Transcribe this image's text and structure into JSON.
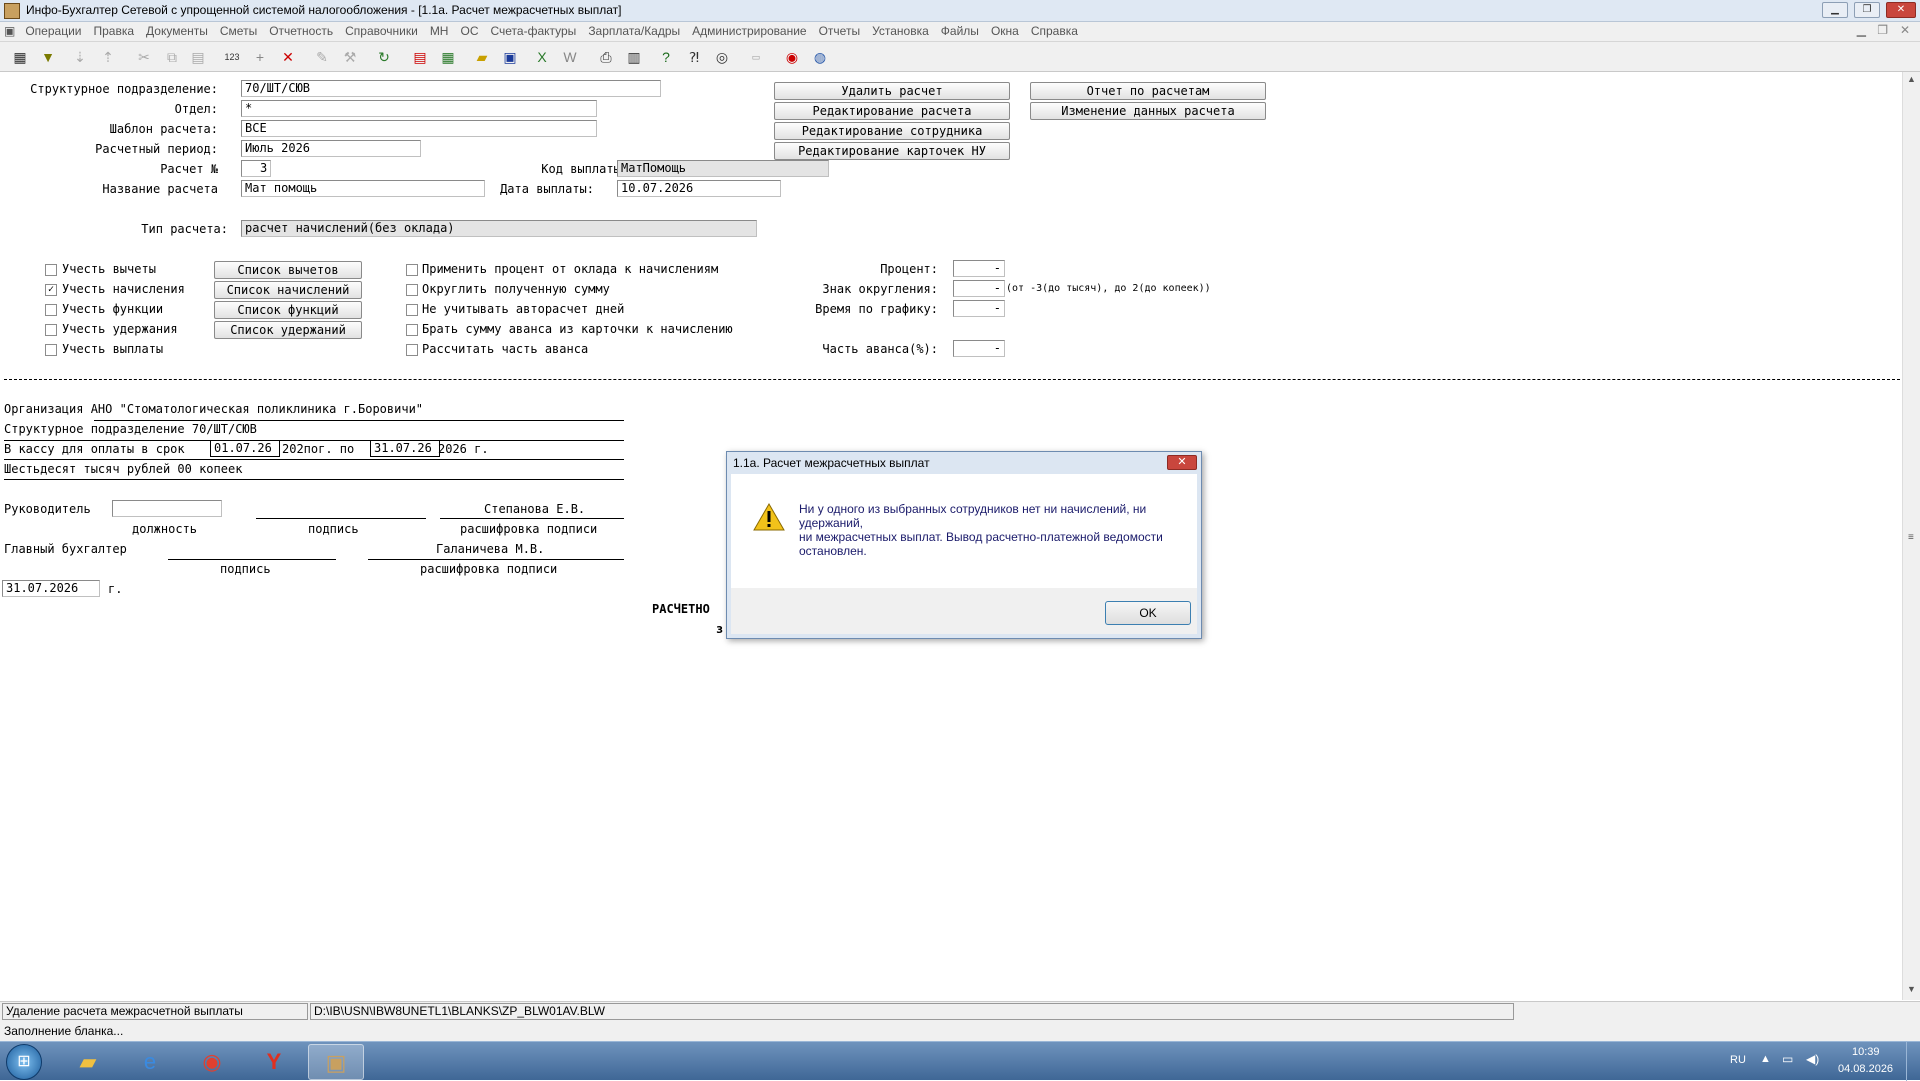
{
  "window": {
    "title": "Инфо-Бухгалтер Сетевой с упрощенной системой налогообложения - [1.1а. Расчет межрасчетных выплат]"
  },
  "menu": [
    "Операции",
    "Правка",
    "Документы",
    "Сметы",
    "Отчетность",
    "Справочники",
    "МН",
    "ОС",
    "Счета-фактуры",
    "Зарплата/Кадры",
    "Администрирование",
    "Отчеты",
    "Установка",
    "Файлы",
    "Окна",
    "Справка"
  ],
  "form": {
    "struct_label": "Структурное подразделение:",
    "struct_value": "70/ШТ/СЮВ",
    "dept_label": "Отдел:",
    "dept_value": "*",
    "template_label": "Шаблон расчета:",
    "template_value": "ВСЕ",
    "period_label": "Расчетный период:",
    "period_value": "Июль 2026",
    "calc_no_label": "Расчет №",
    "calc_no_value": "3",
    "code_label": "Код выплаты:",
    "code_value": "МатПомощь",
    "name_label": "Название расчета",
    "name_value": "Мат помощь",
    "date_label": "Дата выплаты:",
    "date_value": "10.07.2026",
    "type_label": "Тип расчета:",
    "type_value": "расчет начислений(без оклада)"
  },
  "buttons": {
    "delete": "Удалить расчет",
    "edit": "Редактирование расчета",
    "edit_employee": "Редактирование сотрудника",
    "edit_cards": "Редактирование карточек НУ",
    "report": "Отчет по расчетам",
    "change": "Изменение данных расчета"
  },
  "checks": [
    {
      "label": "Учесть вычеты",
      "checked": false,
      "btn": "Список вычетов"
    },
    {
      "label": "Учесть начисления",
      "checked": true,
      "btn": "Список начислений"
    },
    {
      "label": "Учесть функции",
      "checked": false,
      "btn": "Список функций"
    },
    {
      "label": "Учесть удержания",
      "checked": false,
      "btn": "Список удержаний"
    },
    {
      "label": "Учесть выплаты",
      "checked": false,
      "btn": ""
    }
  ],
  "options": [
    "Применить процент от оклада к начислениям",
    "Округлить полученную сумму",
    "Не учитывать авторасчет дней",
    "Брать сумму аванса из карточки к начислению",
    "Рассчитать часть аванса"
  ],
  "params": {
    "percent_label": "Процент:",
    "percent_value": "-",
    "round_label": "Знак округления:",
    "round_value": "-",
    "round_hint": "(от -3(до тысяч), до 2(до копеек))",
    "schedule_label": "Время по графику:",
    "schedule_value": "-",
    "advance_label": "Часть аванса(%):",
    "advance_value": "-"
  },
  "blank": {
    "org": "Организация  АНО \"Стоматологическая поликлиника г.Боровичи\"",
    "struct": "Структурное подразделение 70/ШТ/СЮВ",
    "kassa": "В кассу для оплаты в срок",
    "from": "01.07.26",
    "mid": "202пог. по",
    "to": "31.07.26",
    "suffix": "2026 г.",
    "amount_words": "Шестьдесят тысяч рублей 00 копеек",
    "head": "Руководитель",
    "head_name": "Степанова Е.В.",
    "position": "должность",
    "sign": "подпись",
    "decode": "расшифровка подписи",
    "chief": "Главный бухгалтер",
    "chief_name": "Галаничева М.В.",
    "date": "31.07.2026",
    "year": "г.",
    "partial1": "РАСЧЕТНО",
    "partial2": "з"
  },
  "dialog": {
    "title": "1.1а. Расчет межрасчетных выплат",
    "line1": "Ни у одного из выбранных сотрудников нет ни начислений, ни удержаний,",
    "line2": "ни межрасчетных выплат. Вывод расчетно-платежной ведомости остановлен.",
    "ok": "OK"
  },
  "status": {
    "left": "Удаление расчета межрасчетной выплаты",
    "path": "D:\\IB\\USN\\IBW8UNETL1\\BLANKS\\ZP_BLW01AV.BLW",
    "bottom": "Заполнение бланка..."
  },
  "tray": {
    "lang": "RU",
    "time": "10:39",
    "date": "04.08.2026"
  }
}
